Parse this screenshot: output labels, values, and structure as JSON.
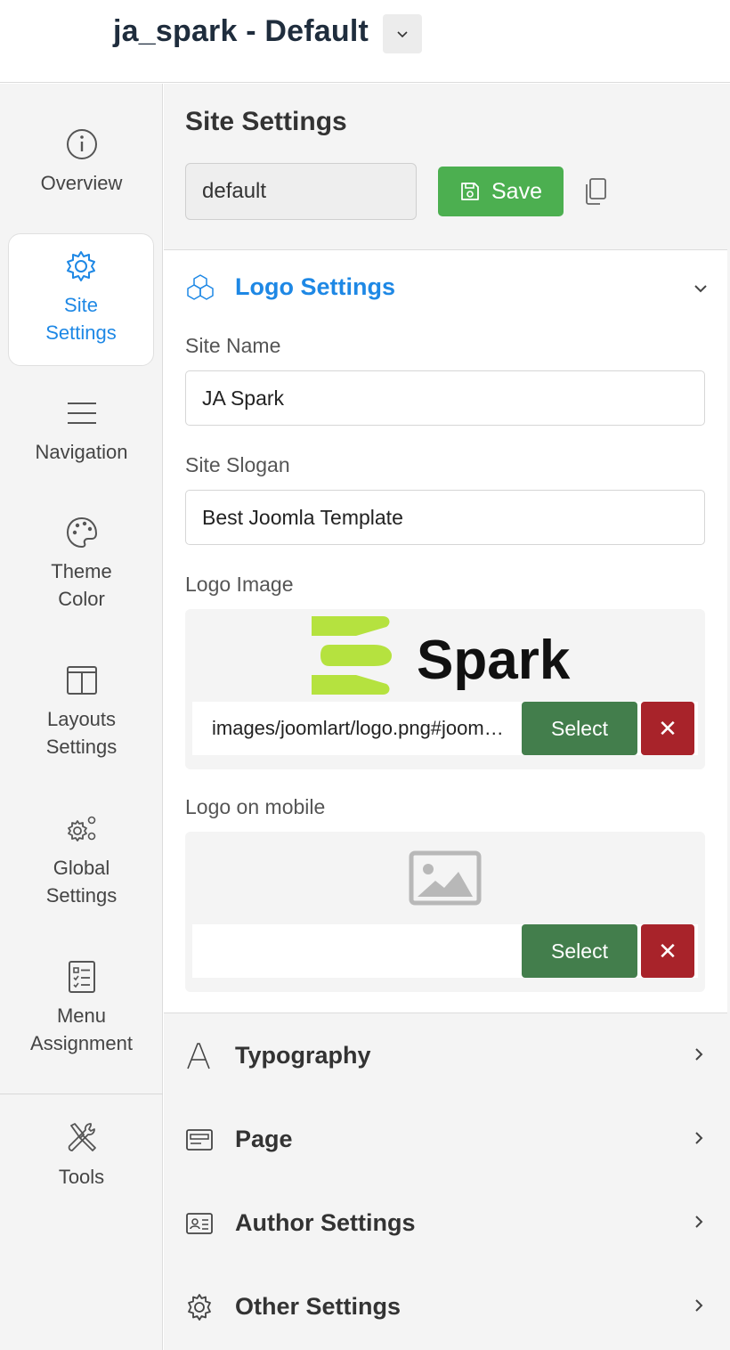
{
  "header": {
    "title": "ja_spark - Default"
  },
  "sidebar": {
    "items": [
      {
        "label": "Overview",
        "icon": "info-icon",
        "active": false
      },
      {
        "label": "Site\nSettings",
        "icon": "gear-icon",
        "active": true
      },
      {
        "label": "Navigation",
        "icon": "hamburger-menu-icon",
        "active": false
      },
      {
        "label": "Theme\nColor",
        "icon": "palette-icon",
        "active": false
      },
      {
        "label": "Layouts\nSettings",
        "icon": "columns-layout-icon",
        "active": false
      },
      {
        "label": "Global\nSettings",
        "icon": "gears-icon",
        "active": false
      },
      {
        "label": "Menu\nAssignment",
        "icon": "checklist-icon",
        "active": false
      },
      {
        "label": "Tools",
        "icon": "tools-icon",
        "active": false
      }
    ]
  },
  "main": {
    "title": "Site Settings",
    "preset_value": "default",
    "save_label": "Save",
    "logo_panel": {
      "title": "Logo Settings",
      "site_name_label": "Site Name",
      "site_name_value": "JA Spark",
      "site_slogan_label": "Site Slogan",
      "site_slogan_value": "Best Joomla Template",
      "logo_image_label": "Logo Image",
      "logo_image_path": "images/joomlart/logo.png#joomlaImage://local-images/joomlart/logo.png",
      "logo_text": "Spark",
      "logo_mobile_label": "Logo on mobile",
      "logo_mobile_path": "",
      "select_label": "Select",
      "clear_label": "✕"
    },
    "sections": [
      {
        "label": "Typography",
        "icon": "typography-icon"
      },
      {
        "label": "Page",
        "icon": "page-icon"
      },
      {
        "label": "Author Settings",
        "icon": "id-card-icon"
      },
      {
        "label": "Other Settings",
        "icon": "gear-icon"
      }
    ]
  },
  "colors": {
    "accent_blue": "#1e88e5",
    "save_green": "#4caf50",
    "select_green": "#437e4c",
    "clear_red": "#a8232a",
    "logo_lime": "#b5e23f"
  }
}
